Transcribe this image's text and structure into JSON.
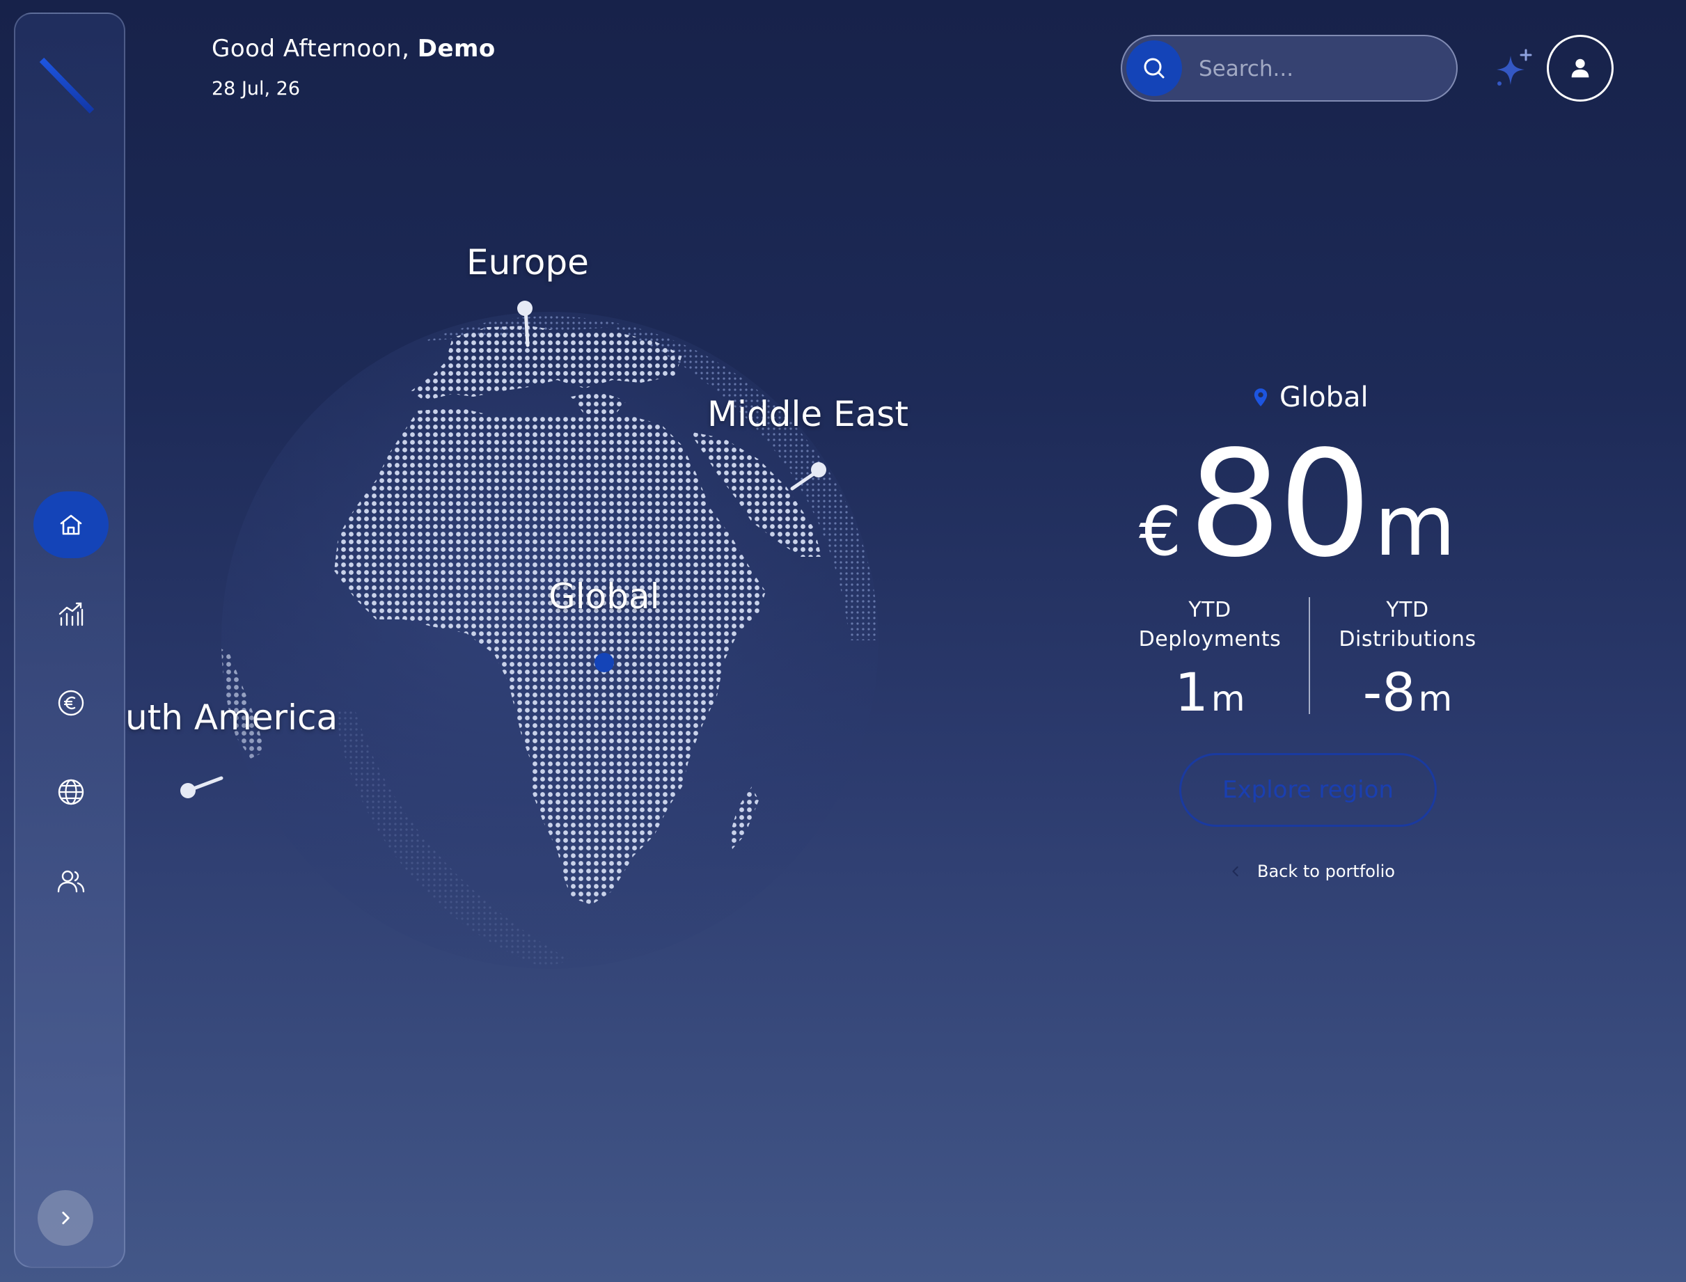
{
  "header": {
    "greeting": "Good Afternoon,",
    "user_name": "Demo",
    "date": "28 Jul, 26"
  },
  "search": {
    "placeholder": "Search..."
  },
  "sidebar": {
    "items": [
      {
        "id": "home",
        "icon": "home-icon",
        "active": true
      },
      {
        "id": "performance",
        "icon": "chart-icon",
        "active": false
      },
      {
        "id": "finance",
        "icon": "euro-icon",
        "active": false
      },
      {
        "id": "regions",
        "icon": "globe-icon",
        "active": false
      },
      {
        "id": "people",
        "icon": "users-icon",
        "active": false
      }
    ]
  },
  "globe": {
    "labels": {
      "europe": "Europe",
      "middle_east": "Middle East",
      "global": "Global",
      "south_america": "uth America"
    }
  },
  "panel": {
    "region": "Global",
    "currency": "€",
    "value": "80",
    "unit": "m",
    "deployments": {
      "label_1": "YTD",
      "label_2": "Deployments",
      "value": "1",
      "unit": "m"
    },
    "distributions": {
      "label_1": "YTD",
      "label_2": "Distributions",
      "value": "-8",
      "unit": "m"
    },
    "explore_label": "Explore region",
    "back_label": "Back to portfolio"
  },
  "colors": {
    "accent": "#1444b8",
    "background_top": "#17224a",
    "background_bottom": "#435788"
  }
}
